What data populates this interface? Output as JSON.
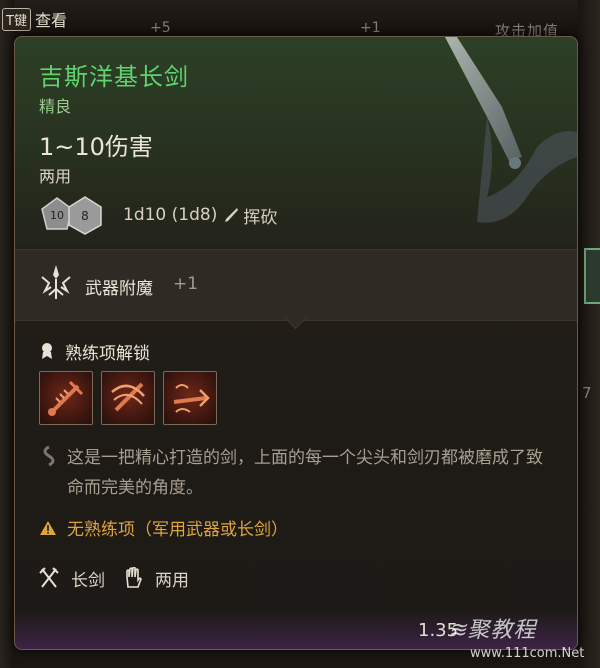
{
  "background": {
    "key_hint": {
      "key": "T键",
      "label": "查看"
    },
    "bonus_left": "+5",
    "bonus_mid": "+1",
    "attack_label": "攻击加值",
    "side_number": "7"
  },
  "tooltip": {
    "name": "吉斯洋基长剑",
    "rarity": "精良",
    "damage": "1~10伤害",
    "handedness": "两用",
    "dice": {
      "formula": "1d10 (1d8)",
      "damage_type": "挥砍",
      "die_faces": [
        "10",
        "8"
      ],
      "icon": "dice-icon"
    },
    "enchantment": {
      "label": "武器附魔",
      "value": "+1",
      "icon": "enchantment-icon"
    },
    "proficiency": {
      "title": "熟练项解锁",
      "icon": "ribbon-icon",
      "actions": [
        {
          "name": "pommel-strike-icon"
        },
        {
          "name": "lacerate-icon"
        },
        {
          "name": "flourish-icon"
        }
      ]
    },
    "description": "这是一把精心打造的剑，上面的每一个尖头和剑刃都被磨成了致命而完美的角度。",
    "warning": "无熟练项（军用武器或长剑）",
    "weapon_type": "长剑",
    "grip": "两用",
    "weight": "1.35"
  },
  "watermark": {
    "brand": "≋聚教程",
    "url": "www.111com.Net"
  },
  "colors": {
    "item_name": "#5fd36e",
    "warning": "#e0a53a",
    "panel_border": "#6b5a48"
  }
}
